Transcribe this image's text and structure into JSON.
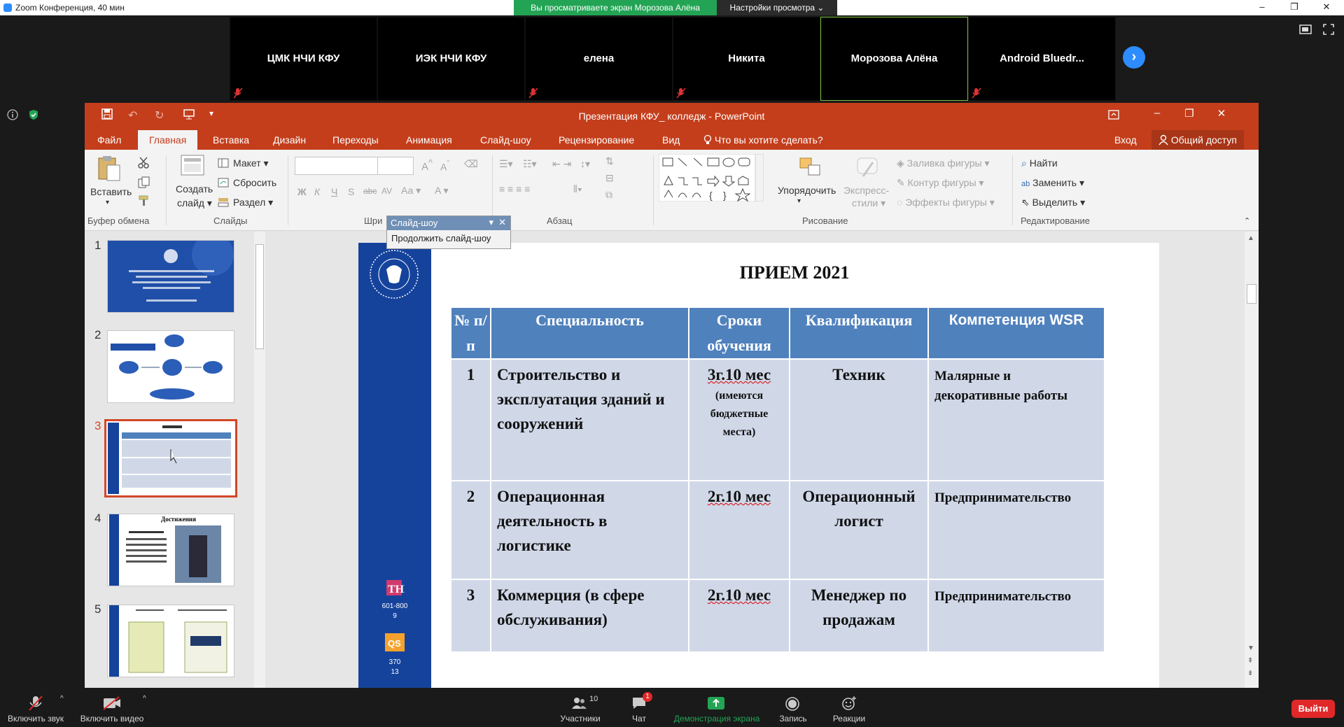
{
  "zoom": {
    "window_title": "Zoom Конференция, 40 мин",
    "share_banner": "Вы просматриваете экран Морозова Алёна",
    "view_settings": "Настройки просмотра",
    "participants_tiles": [
      {
        "name": "ЦМК НЧИ КФУ"
      },
      {
        "name": "ИЭК НЧИ КФУ"
      },
      {
        "name": "елена"
      },
      {
        "name": "Никита"
      },
      {
        "name": "Морозова Алёна"
      },
      {
        "name": "Android  Bluedr..."
      }
    ],
    "toolbar": {
      "unmute": "Включить звук",
      "start_video": "Включить видео",
      "participants": "Участники",
      "participants_count": "10",
      "chat": "Чат",
      "chat_badge": "1",
      "share_screen": "Демонстрация экрана",
      "record": "Запись",
      "reactions": "Реакции",
      "leave": "Выйти"
    },
    "accent_color": "#2d8cff",
    "share_green": "#23a455"
  },
  "ppt": {
    "title": "Презентация КФУ_ колледж - PowerPoint",
    "tabs": [
      "Файл",
      "Главная",
      "Вставка",
      "Дизайн",
      "Переходы",
      "Анимация",
      "Слайд-шоу",
      "Рецензирование",
      "Вид"
    ],
    "active_tab": "Главная",
    "tell_me": "Что вы хотите сделать?",
    "signin": "Вход",
    "share": "Общий доступ",
    "ribbon": {
      "paste": "Вставить",
      "clipboard_group": "Буфер обмена",
      "new_slide_1": "Создать",
      "new_slide_2": "слайд",
      "layout": "Макет",
      "reset": "Сбросить",
      "section": "Раздел",
      "slides_group": "Слайды",
      "font_group": "Шри",
      "paragraph_group": "Абзац",
      "arrange": "Упорядочить",
      "quick_styles_1": "Экспресс-",
      "quick_styles_2": "стили",
      "shape_fill": "Заливка фигуры",
      "shape_outline": "Контур фигуры",
      "shape_effects": "Эффекты фигуры",
      "drawing_group": "Рисование",
      "find": "Найти",
      "replace": "Заменить",
      "select": "Выделить",
      "editing_group": "Редактирование",
      "bold": "Ж",
      "italic": "К",
      "underline": "Ч",
      "strike": "S",
      "abc": "abc",
      "case": "Аа"
    },
    "slideshow_popup": {
      "title": "Слайд-шоу",
      "continue": "Продолжить слайд-шоу"
    },
    "thumbnails": [
      "1",
      "2",
      "3",
      "4",
      "5"
    ],
    "selected_thumbnail": "3",
    "theme_color": "#c43e1c"
  },
  "slide": {
    "title": "ПРИЕМ 2021",
    "side_stats": {
      "rank1": "601-800",
      "rank1b": "9",
      "rank2": "370",
      "rank2b": "13"
    },
    "table": {
      "headers": [
        "№ п/п",
        "Специальность",
        "Сроки обучения",
        "Квалификация",
        "Компетенция WSR"
      ],
      "rows": [
        {
          "num": "1",
          "spec": "Строительство и эксплуатация зданий и сооружений",
          "term": "3г.10 мес",
          "term_note": "(имеются бюджетные места)",
          "qual": "Техник",
          "wsr": "Малярные и декоративные работы"
        },
        {
          "num": "2",
          "spec": "Операционная деятельность в логистике",
          "term": "2г.10 мес",
          "term_note": "",
          "qual": "Операционный логист",
          "wsr": "Предпринимательство"
        },
        {
          "num": "3",
          "spec": "Коммерция (в сфере обслуживания)",
          "term": "2г.10 мес",
          "term_note": "",
          "qual": "Менеджер по продажам",
          "wsr": "Предпринимательство"
        }
      ]
    },
    "header_color": "#4f81bd",
    "cell_color": "#d0d8e8",
    "bar_color": "#15439c"
  },
  "thumb_texts": {
    "t4_title": "Достижения"
  }
}
